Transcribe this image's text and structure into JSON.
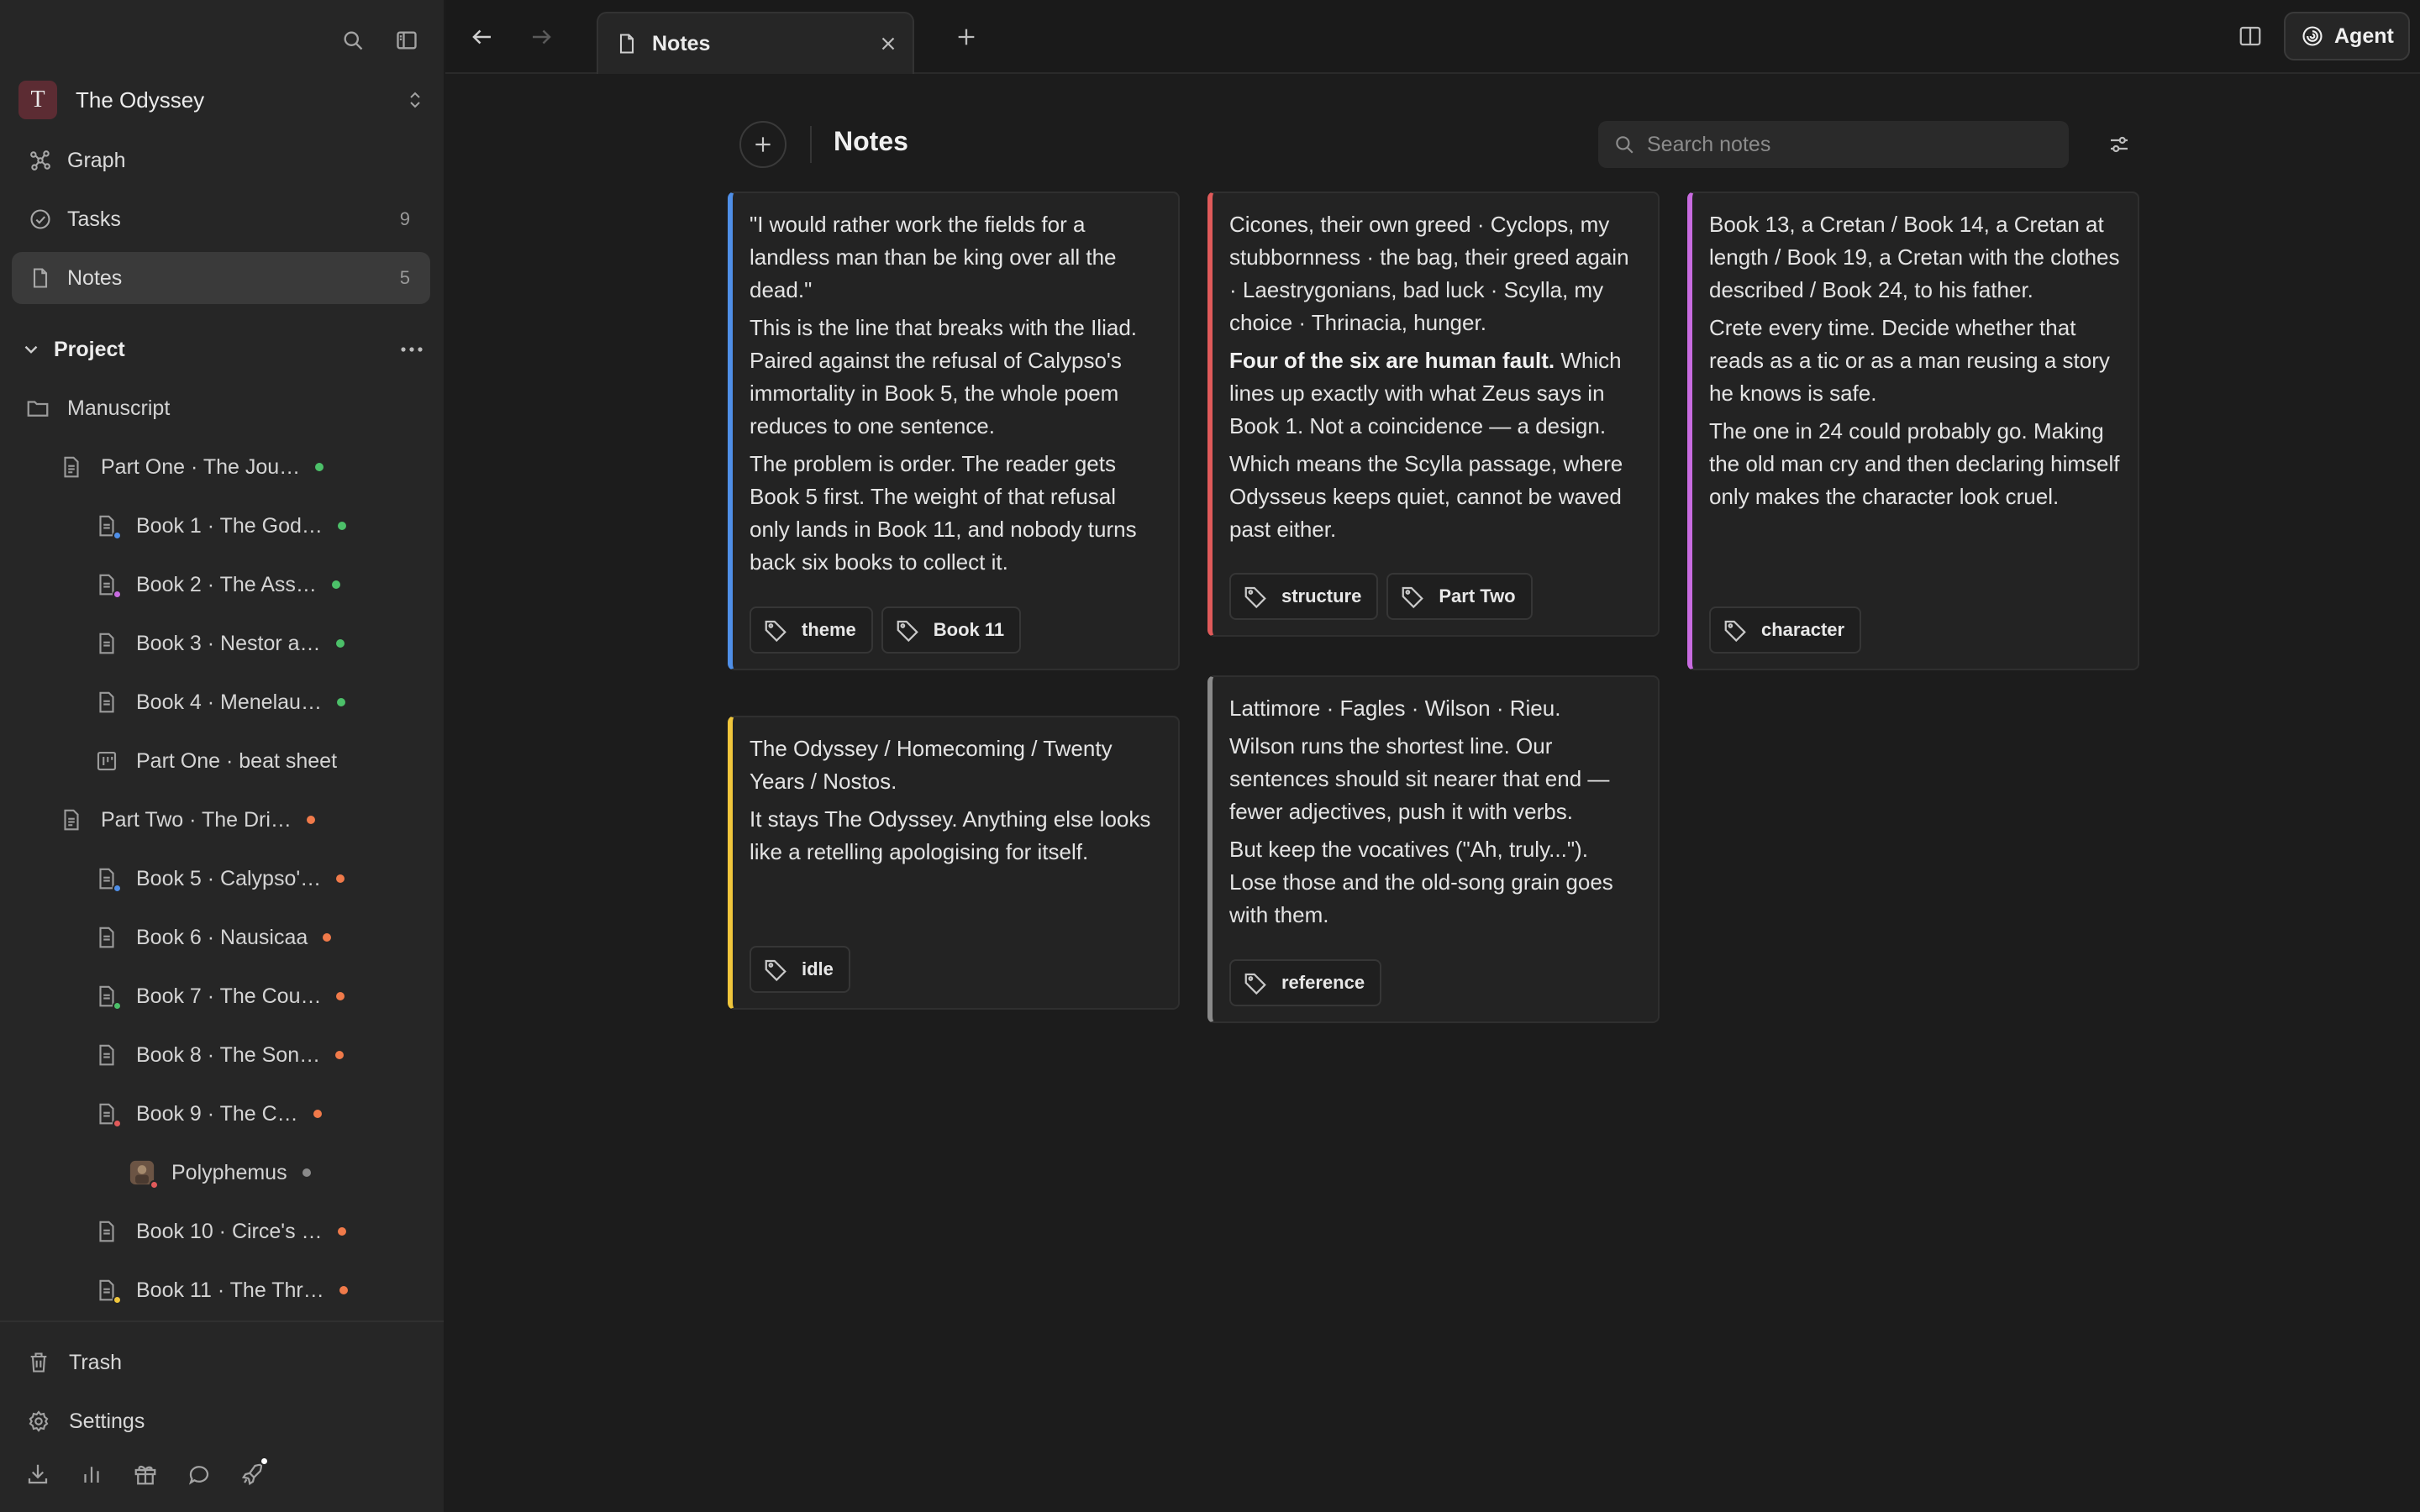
{
  "workspace": {
    "initial": "T",
    "name": "The Odyssey"
  },
  "nav": [
    {
      "label": "Graph",
      "count": ""
    },
    {
      "label": "Tasks",
      "count": "9"
    },
    {
      "label": "Notes",
      "count": "5"
    }
  ],
  "project": {
    "label": "Project"
  },
  "tree": [
    {
      "label": "Manuscript"
    },
    {
      "label": "Part One · The Jou…"
    },
    {
      "label": "Book 1 · The God…"
    },
    {
      "label": "Book 2 · The Ass…"
    },
    {
      "label": "Book 3 · Nestor a…"
    },
    {
      "label": "Book 4 · Menelau…"
    },
    {
      "label": "Part One · beat sheet"
    },
    {
      "label": "Part Two · The Dri…"
    },
    {
      "label": "Book 5 · Calypso'…"
    },
    {
      "label": "Book 6 · Nausicaa"
    },
    {
      "label": "Book 7 · The Cou…"
    },
    {
      "label": "Book 8 · The Son…"
    },
    {
      "label": "Book 9 · The C…"
    },
    {
      "label": "Polyphemus"
    },
    {
      "label": "Book 10 · Circe's …"
    },
    {
      "label": "Book 11 · The Thr…"
    }
  ],
  "bottom": {
    "trash": "Trash",
    "settings": "Settings"
  },
  "tab": {
    "label": "Notes"
  },
  "agent": {
    "label": "Agent"
  },
  "page": {
    "title": "Notes",
    "search_placeholder": "Search notes"
  },
  "colors": {
    "blue": "#4f8fe8",
    "red": "#e05a5a",
    "pink": "#c86be0",
    "yellow": "#f0c63c",
    "gray": "#8a8a8a",
    "green": "#4cc069",
    "orange": "#f07a4a"
  },
  "notes": [
    {
      "paras": [
        "\"I would rather work the fields for a landless man than be king over all the dead.\"",
        "This is the line that breaks with the Iliad. Paired against the refusal of Calypso's immortality in Book 5, the whole poem reduces to one sentence.",
        "The problem is order. The reader gets Book 5 first. The weight of that refusal only lands in Book 11, and nobody turns back six books to collect it."
      ],
      "tags": [
        "theme",
        "Book 11"
      ]
    },
    {
      "paras": [
        "Cicones, their own greed · Cyclops, my stubbornness · the bag, their greed again · Laestrygonians, bad luck · Scylla, my choice · Thrinacia, hunger."
      ],
      "bold": "Four of the six are human fault.",
      "after_bold": " Which lines up exactly with what Zeus says in Book 1. Not a coincidence — a design.",
      "paras2": [
        "Which means the Scylla passage, where Odysseus keeps quiet, cannot be waved past either."
      ],
      "tags": [
        "structure",
        "Part Two"
      ]
    },
    {
      "paras": [
        "Book 13, a Cretan / Book 14, a Cretan at length / Book 19, a Cretan with the clothes described / Book 24, to his father.",
        "Crete every time. Decide whether that reads as a tic or as a man reusing a story he knows is safe.",
        "The one in 24 could probably go. Making the old man cry and then declaring himself only makes the character look cruel."
      ],
      "tags": [
        "character"
      ]
    },
    {
      "paras": [
        "The Odyssey / Homecoming / Twenty Years / Nostos.",
        "It stays The Odyssey. Anything else looks like a retelling apologising for itself."
      ],
      "tags": [
        "idle"
      ]
    },
    {
      "paras": [
        "Lattimore · Fagles · Wilson · Rieu.",
        "Wilson runs the shortest line. Our sentences should sit nearer that end — fewer adjectives, push it with verbs.",
        "But keep the vocatives (\"Ah, truly...\"). Lose those and the old-song grain goes with them."
      ],
      "tags": [
        "reference"
      ]
    }
  ]
}
